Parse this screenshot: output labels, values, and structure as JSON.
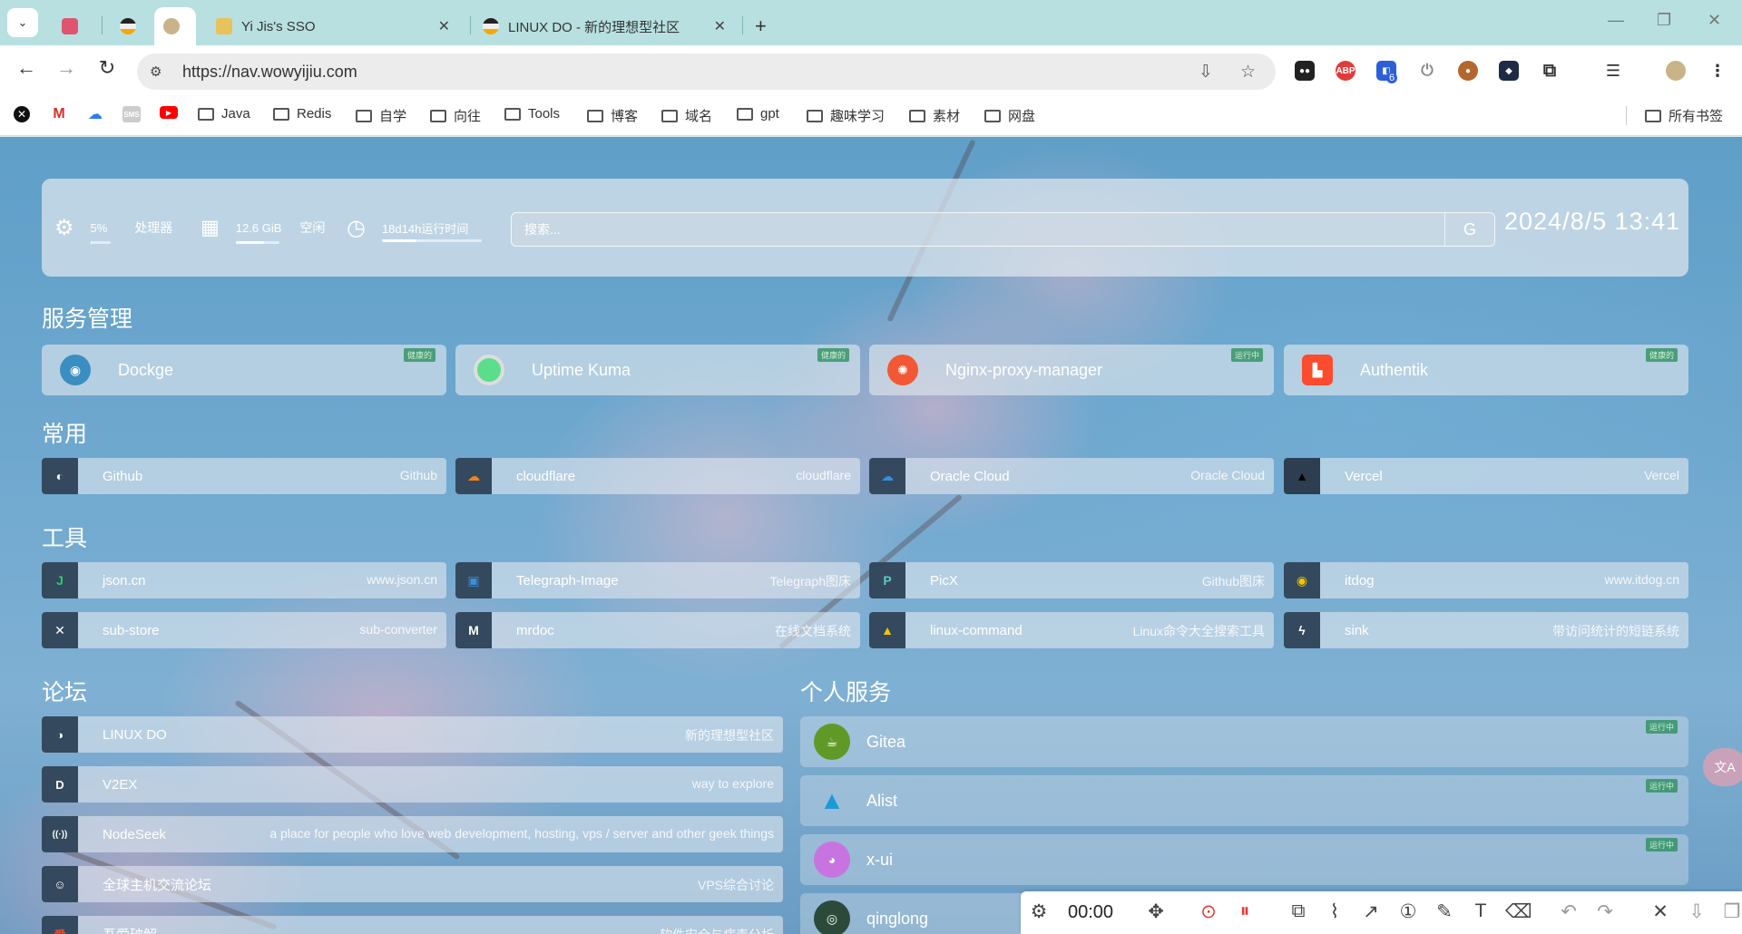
{
  "browser": {
    "tabs": [
      {
        "title": "",
        "icon": "translate-app-icon"
      },
      {
        "title": "",
        "icon": "linuxdo-icon"
      },
      {
        "title": "",
        "icon": "site-avatar-icon"
      },
      {
        "title": "Yi Jis's SSO",
        "icon": "lock-icon"
      },
      {
        "title": "LINUX DO - 新的理想型社区",
        "icon": "linuxdo-icon"
      }
    ],
    "new_tab": "+",
    "url": "https://nav.wowyijiu.com",
    "bookmarks": [
      {
        "label": "",
        "icon": "ai-icon"
      },
      {
        "label": "",
        "icon": "gmail-icon"
      },
      {
        "label": "",
        "icon": "cloud-icon"
      },
      {
        "label": "",
        "icon": "sms-icon"
      },
      {
        "label": "",
        "icon": "youtube-icon"
      },
      {
        "label": "Java",
        "icon": "folder-icon"
      },
      {
        "label": "Redis",
        "icon": "folder-icon"
      },
      {
        "label": "自学",
        "icon": "folder-icon"
      },
      {
        "label": "向往",
        "icon": "folder-icon"
      },
      {
        "label": "Tools",
        "icon": "folder-icon"
      },
      {
        "label": "博客",
        "icon": "folder-icon"
      },
      {
        "label": "域名",
        "icon": "folder-icon"
      },
      {
        "label": "gpt",
        "icon": "folder-icon"
      },
      {
        "label": "趣味学习",
        "icon": "folder-icon"
      },
      {
        "label": "素材",
        "icon": "folder-icon"
      },
      {
        "label": "网盘",
        "icon": "folder-icon"
      }
    ],
    "all_bookmarks": "所有书签",
    "ext_badge": "6"
  },
  "status": {
    "cpu_value": "5%",
    "cpu_label": "处理器",
    "cpu_fraction": 0.05,
    "mem_value": "12.6 GiB",
    "mem_label": "空闲",
    "mem_fraction": 0.65,
    "uptime_value": "18d14h运行时间",
    "uptime_fraction": 0.35,
    "search_placeholder": "搜索...",
    "search_engine": "G",
    "datetime": "2024/8/5 13:41"
  },
  "sections": {
    "services_title": "服务管理",
    "common_title": "常用",
    "tools_title": "工具",
    "forum_title": "论坛",
    "personal_title": "个人服务"
  },
  "services": [
    {
      "name": "Dockge",
      "tag": "健康的",
      "color": "#3b8ec2"
    },
    {
      "name": "Uptime Kuma",
      "tag": "健康的",
      "color": "#5cdd8b"
    },
    {
      "name": "Nginx-proxy-manager",
      "tag": "运行中",
      "color": "#f15833"
    },
    {
      "name": "Authentik",
      "tag": "健康的",
      "color": "#fd4b2d"
    }
  ],
  "common": [
    {
      "name": "Github",
      "desc": "Github",
      "glyph": "◐"
    },
    {
      "name": "cloudflare",
      "desc": "cloudflare",
      "glyph": "☁"
    },
    {
      "name": "Oracle Cloud",
      "desc": "Oracle Cloud",
      "glyph": "☁"
    },
    {
      "name": "Vercel",
      "desc": "Vercel",
      "glyph": "▲"
    }
  ],
  "tools": [
    {
      "name": "json.cn",
      "desc": "www.json.cn",
      "glyph": "J"
    },
    {
      "name": "Telegraph-Image",
      "desc": "Telegraph图床",
      "glyph": "▣"
    },
    {
      "name": "PicX",
      "desc": "Github图床",
      "glyph": "P"
    },
    {
      "name": "itdog",
      "desc": "www.itdog.cn",
      "glyph": "◉"
    },
    {
      "name": "sub-store",
      "desc": "sub-converter",
      "glyph": "✕"
    },
    {
      "name": "mrdoc",
      "desc": "在线文档系统",
      "glyph": "M"
    },
    {
      "name": "linux-command",
      "desc": "Linux命令大全搜索工具",
      "glyph": "▲"
    },
    {
      "name": "sink",
      "desc": "带访问统计的短链系统",
      "glyph": "ϟ"
    }
  ],
  "forums": [
    {
      "name": "LINUX DO",
      "desc": "新的理想型社区",
      "glyph": "◑"
    },
    {
      "name": "V2EX",
      "desc": "way to explore",
      "glyph": "D"
    },
    {
      "name": "NodeSeek",
      "desc": "a place for people who love web development, hosting, vps / server and other geek things",
      "glyph": "((·))"
    },
    {
      "name": "全球主机交流论坛",
      "desc": "VPS综合讨论",
      "glyph": "☺"
    },
    {
      "name": "吾爱破解",
      "desc": "软件安全与病毒分析",
      "glyph": "爱"
    }
  ],
  "personal": [
    {
      "name": "Gitea",
      "tag": "运行中",
      "color": "#609926"
    },
    {
      "name": "Alist",
      "tag": "运行中",
      "color": "#1b9ad6"
    },
    {
      "name": "x-ui",
      "tag": "运行中",
      "color": "#c874e0"
    },
    {
      "name": "qinglong",
      "tag": "",
      "color": "#2b4a3a"
    }
  ],
  "recorder": {
    "time": "00:00"
  },
  "translate_fab": "文A"
}
